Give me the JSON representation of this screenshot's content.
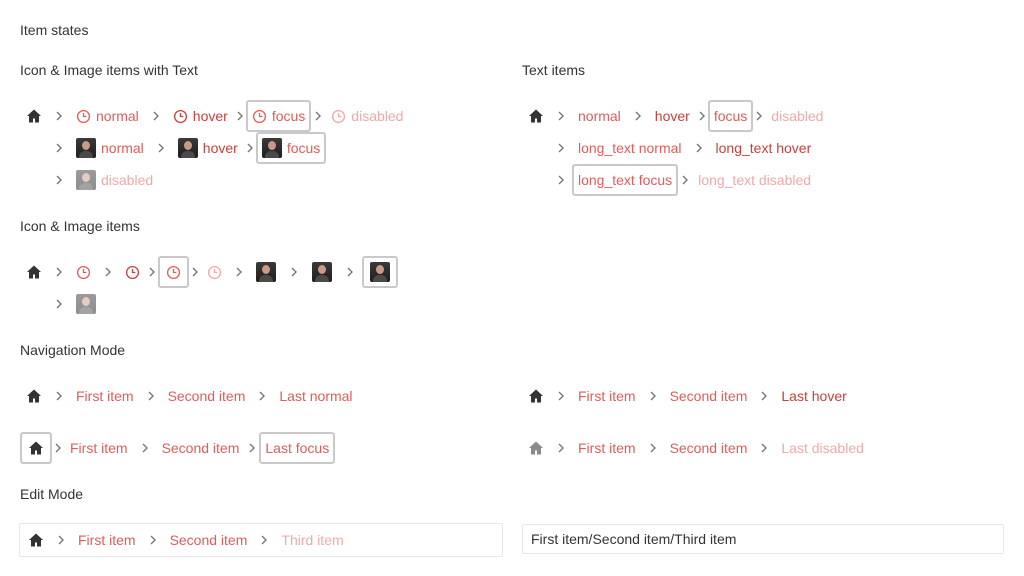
{
  "page_title": "Item states",
  "sections": {
    "icon_image_text": "Icon & Image items with Text",
    "text_items": "Text items",
    "icon_image": "Icon & Image items",
    "navigation_mode": "Navigation Mode",
    "edit_mode": "Edit Mode"
  },
  "icon_image_text": {
    "row1": [
      "normal",
      "hover",
      "focus",
      "disabled"
    ],
    "row2": [
      "normal",
      "hover",
      "focus"
    ],
    "row3": [
      "disabled"
    ]
  },
  "text_items": {
    "row1": [
      "normal",
      "hover",
      "focus",
      "disabled"
    ],
    "row2": [
      "long_text normal",
      "long_text hover"
    ],
    "row3": [
      "long_text focus",
      "long_text disabled"
    ]
  },
  "navigation": {
    "normal": [
      "First item",
      "Second item",
      "Last normal"
    ],
    "hover": [
      "First item",
      "Second item",
      "Last hover"
    ],
    "focus": [
      "First item",
      "Second item",
      "Last focus"
    ],
    "disabled": [
      "First item",
      "Second item",
      "Last disabled"
    ]
  },
  "edit_mode": {
    "crumbs": [
      "First item",
      "Second item",
      "Third item"
    ],
    "input_value": "First item/Second item/Third item"
  },
  "colors": {
    "link": "#e05c5a",
    "link_hover": "#c93f3d",
    "link_disabled": "#f0a9a8",
    "focus_border": "#c9c9c9",
    "text": "#333333"
  },
  "icons": {
    "home": "home-icon",
    "separator": "chevron-right-icon",
    "item_icon": "clock-icon",
    "item_image": "avatar-image"
  }
}
